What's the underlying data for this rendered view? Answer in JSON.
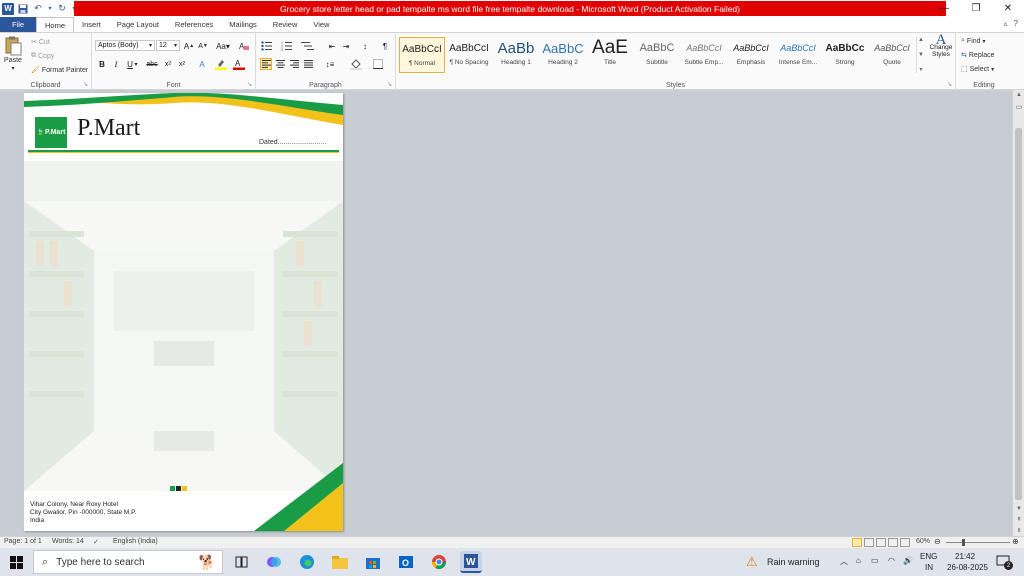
{
  "window": {
    "title": "Grocery store letter head or pad tempalte ms word file free tempalte download  -  Microsoft Word (Product Activation Failed)",
    "title_bar_color": "#e00000"
  },
  "tabs": [
    "File",
    "Home",
    "Insert",
    "Page Layout",
    "References",
    "Mailings",
    "Review",
    "View"
  ],
  "active_tab": "Home",
  "ribbon": {
    "clipboard": {
      "label": "Clipboard",
      "paste": "Paste",
      "cut": "Cut",
      "copy": "Copy",
      "format_painter": "Format Painter"
    },
    "font": {
      "label": "Font",
      "font_name": "Aptos (Body)",
      "font_size": "12"
    },
    "paragraph": {
      "label": "Paragraph"
    },
    "styles": {
      "label": "Styles",
      "items": [
        {
          "sample": "AaBbCcI",
          "name": "¶ Normal"
        },
        {
          "sample": "AaBbCcI",
          "name": "¶ No Spacing"
        },
        {
          "sample": "AaBb",
          "name": "Heading 1"
        },
        {
          "sample": "AaBbC",
          "name": "Heading 2"
        },
        {
          "sample": "AaE",
          "name": "Title"
        },
        {
          "sample": "AaBbC",
          "name": "Subtitle"
        },
        {
          "sample": "AaBbCcI",
          "name": "Subtle Emp..."
        },
        {
          "sample": "AaBbCcI",
          "name": "Emphasis"
        },
        {
          "sample": "AaBbCcI",
          "name": "Intense Em..."
        },
        {
          "sample": "AaBbCc",
          "name": "Strong"
        },
        {
          "sample": "AaBbCcI",
          "name": "Quote"
        }
      ],
      "change_styles": "Change Styles"
    },
    "editing": {
      "label": "Editing",
      "find": "Find",
      "replace": "Replace",
      "select": "Select"
    }
  },
  "document": {
    "brand": "P.Mart",
    "logo_text": "P.Mart",
    "dated_label": "Dated.........................",
    "address_lines": [
      "Vihar Colony, Near Roxy Hotel",
      "City Gwalior, Pin -000000, State M.P.",
      "India"
    ],
    "colors": {
      "green": "#1a9c47",
      "yellow": "#f3c21a"
    }
  },
  "statusbar": {
    "page": "Page: 1 of 1",
    "words": "Words: 14",
    "language": "English (India)",
    "zoom": "60%"
  },
  "taskbar": {
    "search_placeholder": "Type here to search",
    "weather": "Rain warning",
    "lang_top": "ENG",
    "lang_bottom": "IN",
    "time": "21:42",
    "date": "26-08-2025",
    "notifications": "2"
  }
}
